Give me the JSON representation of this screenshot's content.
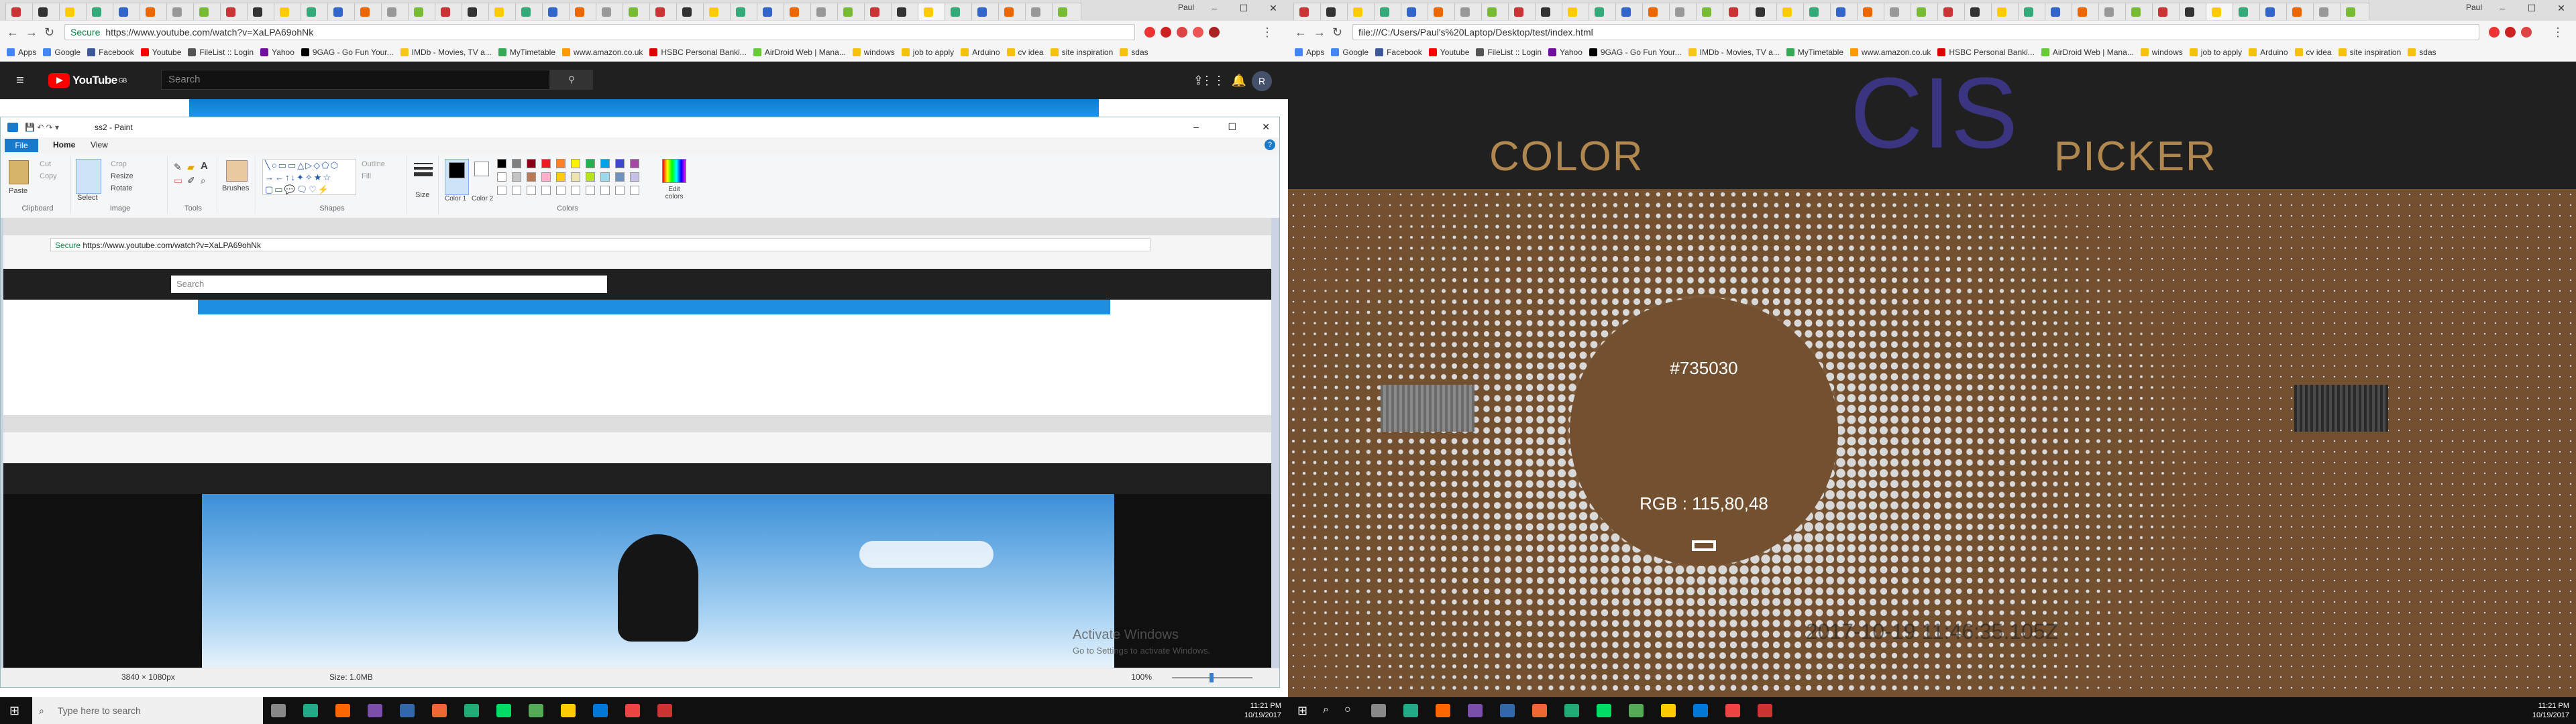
{
  "left": {
    "browser": {
      "profile": "Paul",
      "url": "https://www.youtube.com/watch?v=XaLPA69ohNk",
      "secure_label": "Secure",
      "bookmarks": [
        "Apps",
        "Google",
        "Facebook",
        "Youtube",
        "FileList :: Login",
        "Yahoo",
        "9GAG - Go Fun Your...",
        "IMDb - Movies, TV a...",
        "MyTimetable",
        "www.amazon.co.uk",
        "HSBC Personal Banki...",
        "AirDroid Web | Mana...",
        "windows",
        "job to apply",
        "Arduino",
        "cv idea",
        "site inspiration",
        "sdas"
      ]
    },
    "youtube": {
      "logo_text": "YouTube",
      "logo_sup": "GB",
      "search_placeholder": "Search",
      "avatar_letter": "R"
    },
    "paint": {
      "title": "ss2 - Paint",
      "tabs": [
        "File",
        "Home",
        "View"
      ],
      "groups": [
        "Clipboard",
        "Image",
        "Tools",
        "Brushes",
        "Shapes",
        "Size",
        "Colors"
      ],
      "clipboard": {
        "paste": "Paste",
        "cut": "Cut",
        "copy": "Copy"
      },
      "image": {
        "select": "Select",
        "crop": "Crop",
        "resize": "Resize",
        "rotate": "Rotate"
      },
      "shapes_opts": {
        "outline": "Outline",
        "fill": "Fill"
      },
      "size_label": "Size",
      "color1": "Color 1",
      "color2": "Color 2",
      "edit_colors": "Edit colors",
      "status": {
        "dims": "3840 × 1080px",
        "size": "Size: 1.0MB",
        "zoom": "100%"
      },
      "palette": [
        "#000000",
        "#7f7f7f",
        "#880015",
        "#ed1c24",
        "#ff7f27",
        "#fff200",
        "#22b14c",
        "#00a2e8",
        "#3f48cc",
        "#a349a4",
        "#ffffff",
        "#c3c3c3",
        "#b97a57",
        "#ffaec9",
        "#ffc90e",
        "#efe4b0",
        "#b5e61d",
        "#99d9ea",
        "#7092be",
        "#c8bfe7"
      ]
    },
    "watermark": {
      "line1": "Activate Windows",
      "line2": "Go to Settings to activate Windows."
    },
    "taskbar": {
      "search": "Type here to search",
      "time": "11:21 PM",
      "date": "10/19/2017"
    }
  },
  "right": {
    "browser": {
      "profile": "Paul",
      "url": "file:///C:/Users/Paul's%20Laptop/Desktop/test/index.html"
    },
    "header": {
      "color": "COLOR",
      "cis": "CIS",
      "picker": "PICKER"
    },
    "picker": {
      "hex": "#735030",
      "rgb": "RGB : 115,80,48",
      "stamp": "2017-10-19 11:46:35.105Z"
    },
    "taskbar": {
      "time": "11:21 PM",
      "date": "10/19/2017"
    }
  },
  "colors": {
    "picked": "#735030",
    "title_gold": "#b18750",
    "title_purple": "#3b3480"
  }
}
